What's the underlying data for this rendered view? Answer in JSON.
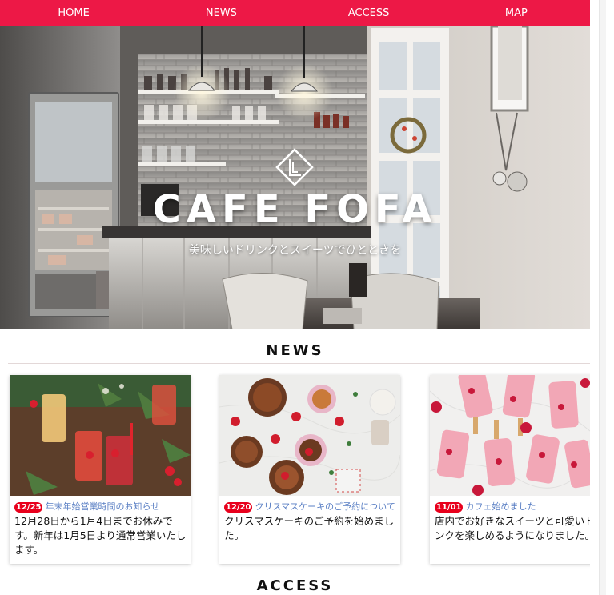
{
  "nav": {
    "items": [
      {
        "label": "HOME"
      },
      {
        "label": "NEWS"
      },
      {
        "label": "ACCESS"
      },
      {
        "label": "MAP"
      }
    ],
    "color": "#ed1846"
  },
  "hero": {
    "title": "CAFE FOFA",
    "tagline": "美味しいドリンクとスイーツでひとときを"
  },
  "news": {
    "heading": "NEWS",
    "items": [
      {
        "date": "12/25",
        "headline": "年末年始営業時間のお知らせ",
        "body": "12月28日から1月4日までお休みです。新年は1月5日より通常営業いたします。"
      },
      {
        "date": "12/20",
        "headline": "クリスマスケーキのご予約について",
        "body": "クリスマスケーキのご予約を始めました。"
      },
      {
        "date": "11/01",
        "headline": "カフェ始めました",
        "body": "店内でお好きなスイーツと可愛いドリンクを楽しめるようになりました。"
      }
    ],
    "date_badge_color": "#e8001c",
    "link_color": "#5a7fc4"
  },
  "access": {
    "heading": "ACCESS"
  }
}
